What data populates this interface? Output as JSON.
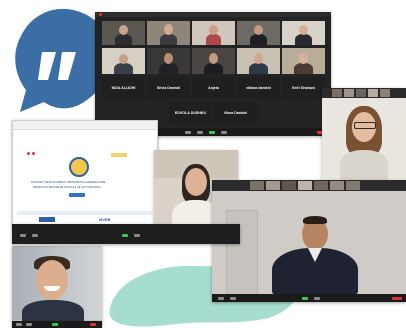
{
  "grid_participants": [
    {
      "name": "NIDA ALLIDHI"
    },
    {
      "name": "Silvia Danishi"
    },
    {
      "name": "Anjela"
    },
    {
      "name": "viliana danishi"
    },
    {
      "name": "Eelri Shahani"
    }
  ],
  "grid_row3": [
    {
      "name": "EDVOLA DUSHKU"
    },
    {
      "name": "Vilma Danishi"
    }
  ],
  "doc_window": {
    "title_text": "PROVIZIA TSE BULDUMENS LIBUNDRETUS GRENERUJORE",
    "subtitle_text": "PERSHCO PA PESTIRE DE SOCIALE E SE QOYTUAR MANS",
    "footer_logo": "MVEB"
  },
  "colors": {
    "speech_blob": "#3a6ea5",
    "teal_blob": "#a7dcd0",
    "zoom_bar": "#1a1a1a",
    "record_red": "#e0342f",
    "active_speaker_green": "#3ec44f"
  },
  "icons": [
    "quote-icon",
    "record-icon",
    "logo-seal-icon"
  ]
}
